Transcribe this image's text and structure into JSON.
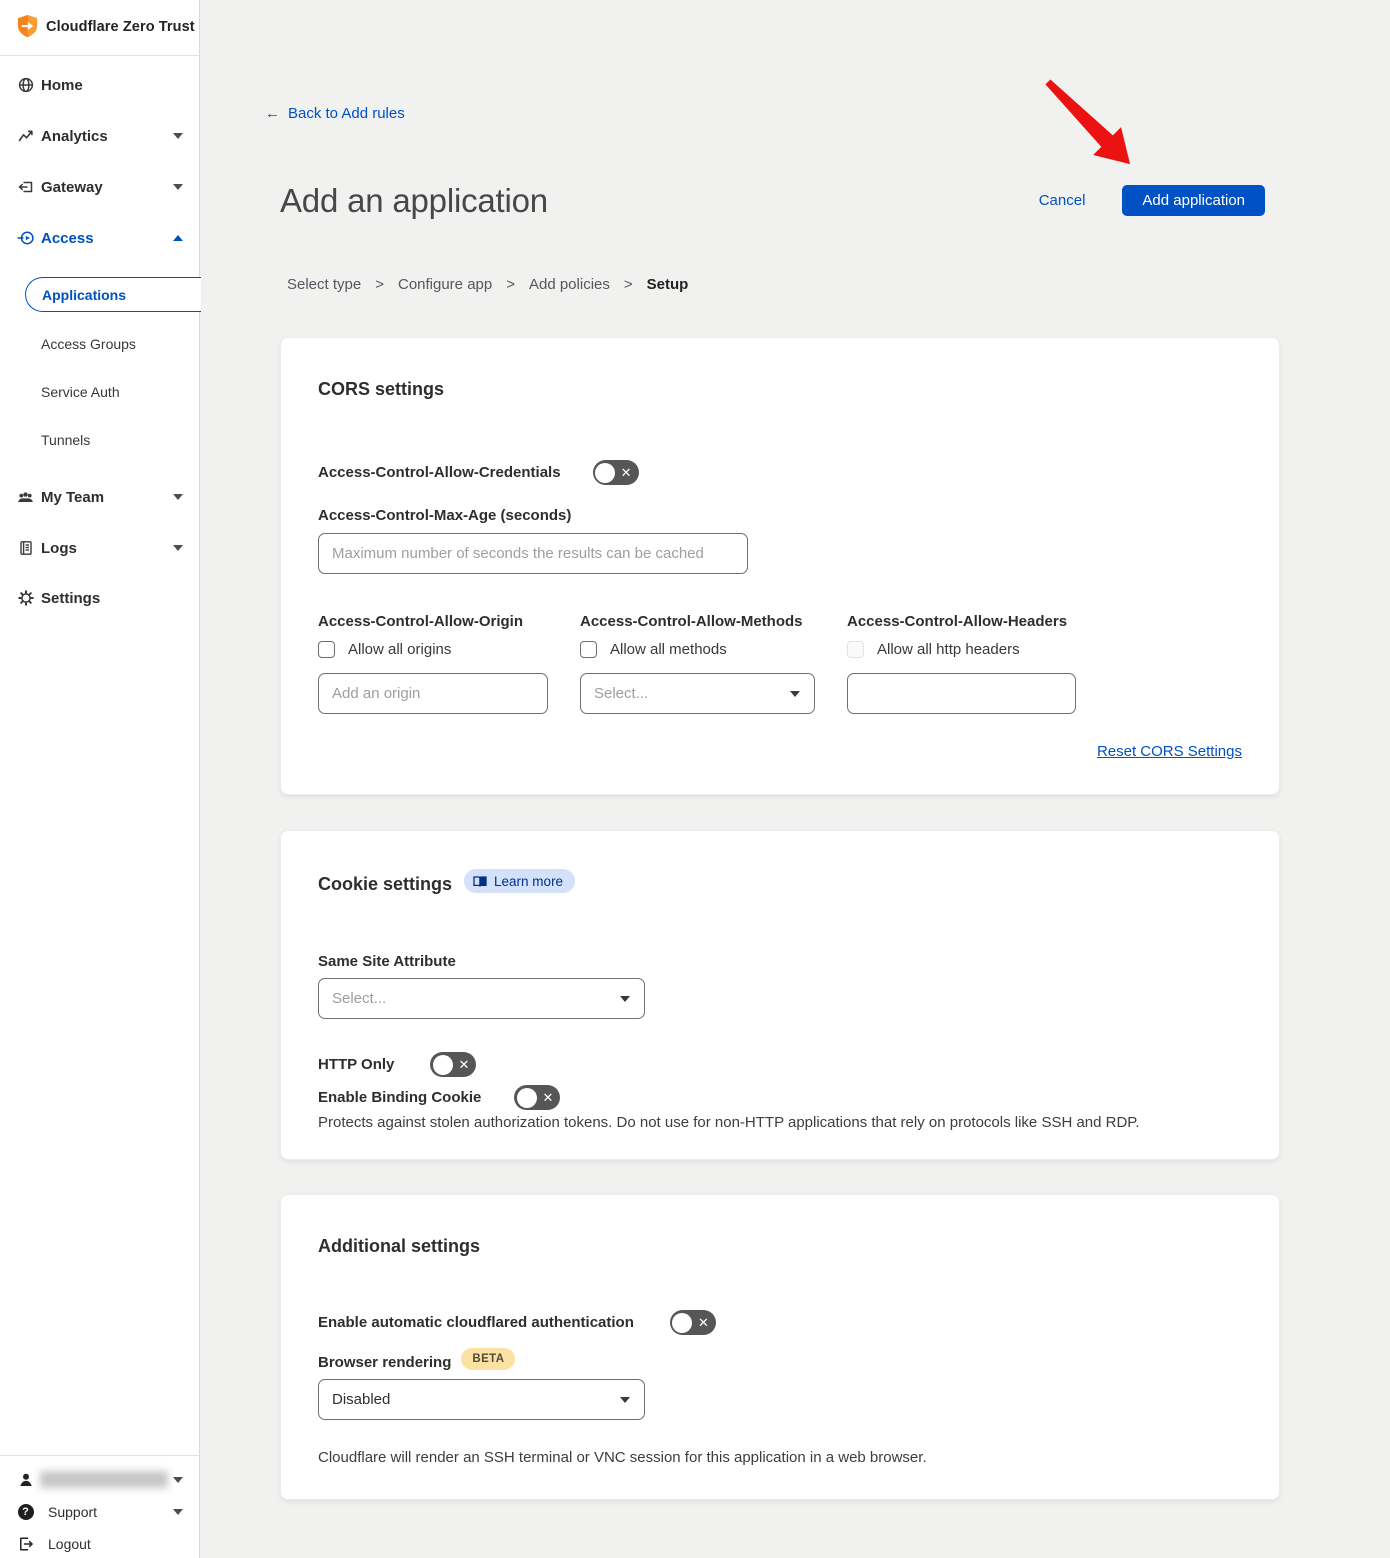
{
  "brand": "Cloudflare Zero Trust",
  "sidebar": {
    "nav": [
      {
        "label": "Home"
      },
      {
        "label": "Analytics"
      },
      {
        "label": "Gateway"
      },
      {
        "label": "Access"
      }
    ],
    "access_subnav": [
      {
        "label": "Applications"
      },
      {
        "label": "Access Groups"
      },
      {
        "label": "Service Auth"
      },
      {
        "label": "Tunnels"
      }
    ],
    "nav2": [
      {
        "label": "My Team"
      },
      {
        "label": "Logs"
      },
      {
        "label": "Settings"
      }
    ],
    "footer": {
      "support_label": "Support",
      "logout_label": "Logout",
      "support_icon_glyph": "?"
    }
  },
  "header": {
    "back_arrow": "←",
    "back_link": "Back to Add rules",
    "title": "Add an application",
    "cancel_label": "Cancel",
    "add_button_label": "Add application",
    "breadcrumb_sep": ">",
    "breadcrumb": [
      {
        "label": "Select type"
      },
      {
        "label": "Configure app"
      },
      {
        "label": "Add policies"
      },
      {
        "label": "Setup"
      }
    ]
  },
  "cors": {
    "title": "CORS settings",
    "credentials_label": "Access-Control-Allow-Credentials",
    "max_age_label": "Access-Control-Max-Age (seconds)",
    "max_age_placeholder": "Maximum number of seconds the results can be cached",
    "origin_label": "Access-Control-Allow-Origin",
    "origin_checkbox": "Allow all origins",
    "origin_placeholder": "Add an origin",
    "methods_label": "Access-Control-Allow-Methods",
    "methods_checkbox": "Allow all methods",
    "methods_select_placeholder": "Select...",
    "headers_label": "Access-Control-Allow-Headers",
    "headers_checkbox": "Allow all http headers",
    "reset_link": "Reset CORS Settings"
  },
  "cookie": {
    "title": "Cookie settings",
    "learn_more": "Learn more",
    "same_site_label": "Same Site Attribute",
    "same_site_placeholder": "Select...",
    "http_only_label": "HTTP Only",
    "binding_label": "Enable Binding Cookie",
    "binding_desc": "Protects against stolen authorization tokens. Do not use for non-HTTP applications that rely on protocols like SSH and RDP."
  },
  "additional": {
    "title": "Additional settings",
    "cloudflared_label": "Enable automatic cloudflared authentication",
    "browser_label": "Browser rendering",
    "beta_badge": "BETA",
    "browser_value": "Disabled",
    "browser_desc": "Cloudflare will render an SSH terminal or VNC session for this application in a web browser."
  },
  "ui": {
    "toggle_off_glyph": "✕"
  },
  "colors": {
    "accent_blue": "#0051c3",
    "brand_orange": "#f6821f",
    "annotation_red": "#ec1212",
    "toggle_off_bg": "#565656",
    "badge_blue_bg": "#d3e1fa",
    "badge_beta_bg": "#fbe2a2",
    "page_bg": "#f1f1f0"
  }
}
